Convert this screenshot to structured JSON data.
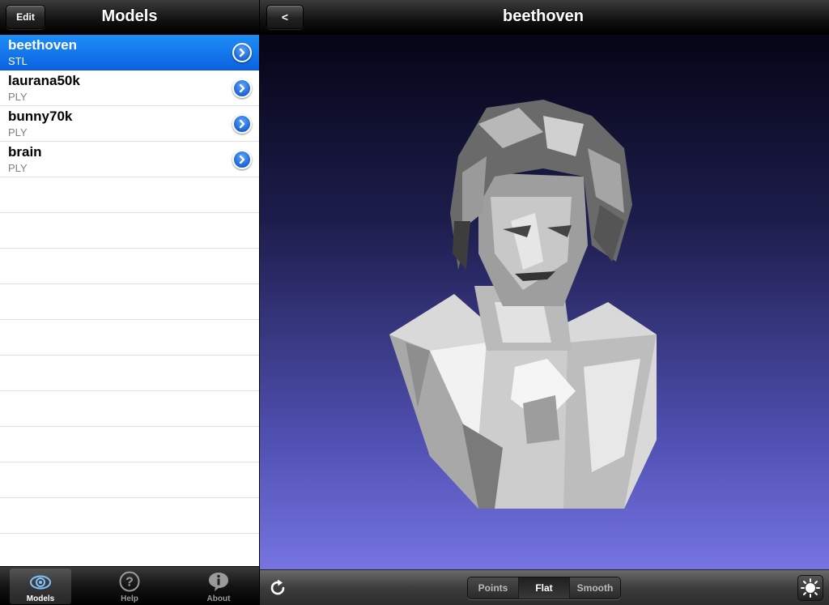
{
  "master": {
    "title": "Models",
    "edit_label": "Edit",
    "models": [
      {
        "name": "beethoven",
        "format": "STL",
        "selected": true
      },
      {
        "name": "laurana50k",
        "format": "PLY",
        "selected": false
      },
      {
        "name": "bunny70k",
        "format": "PLY",
        "selected": false
      },
      {
        "name": "brain",
        "format": "PLY",
        "selected": false
      }
    ],
    "tabs": [
      {
        "label": "Models",
        "icon": "eye-icon",
        "active": true
      },
      {
        "label": "Help",
        "icon": "question-icon",
        "active": false
      },
      {
        "label": "About",
        "icon": "info-icon",
        "active": false
      }
    ]
  },
  "detail": {
    "title": "beethoven",
    "back_label": "<",
    "render_modes": [
      "Points",
      "Flat",
      "Smooth"
    ],
    "active_mode": "Flat"
  },
  "colors": {
    "selection": "#0b63e3",
    "viewport_top": "#050516",
    "viewport_bottom": "#7574e2"
  }
}
